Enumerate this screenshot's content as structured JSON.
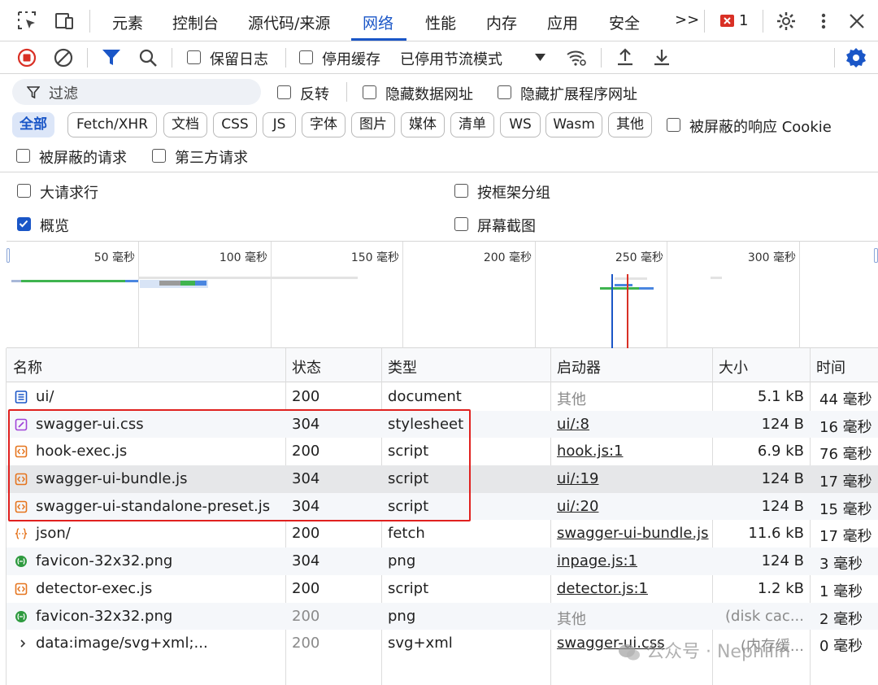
{
  "tabs": [
    "元素",
    "控制台",
    "源代码/来源",
    "网络",
    "性能",
    "内存",
    "应用",
    "安全"
  ],
  "tabbar": {
    "more": ">>",
    "error_count": "1"
  },
  "toolbar": {
    "preserve_log": "保留日志",
    "disable_cache": "停用缓存",
    "throttling": "已停用节流模式"
  },
  "filter": {
    "placeholder": "过滤",
    "invert": "反转",
    "hide_data_urls": "隐藏数据网址",
    "hide_extension_urls": "隐藏扩展程序网址",
    "blocked_cookies": "被屏蔽的响应 Cookie",
    "blocked_requests": "被屏蔽的请求",
    "third_party": "第三方请求"
  },
  "type_filters": [
    "全部",
    "Fetch/XHR",
    "文档",
    "CSS",
    "JS",
    "字体",
    "图片",
    "媒体",
    "清单",
    "WS",
    "Wasm",
    "其他"
  ],
  "settings": {
    "big_rows": "大请求行",
    "group_by_frame": "按框架分组",
    "overview": "概览",
    "screenshots": "屏幕截图"
  },
  "timeline": {
    "labels": [
      "50 毫秒",
      "100 毫秒",
      "150 毫秒",
      "200 毫秒",
      "250 毫秒",
      "300 毫秒"
    ]
  },
  "table": {
    "headers": [
      "名称",
      "状态",
      "类型",
      "启动器",
      "大小",
      "时间"
    ],
    "rows": [
      {
        "name": "ui/",
        "status": "200",
        "type": "document",
        "initiator": "其他",
        "size": "5.1 kB",
        "time": "44 毫秒",
        "icon": "document-icon"
      },
      {
        "name": "swagger-ui.css",
        "status": "304",
        "type": "stylesheet",
        "initiator": "ui/:8",
        "size": "124 B",
        "time": "16 毫秒",
        "icon": "stylesheet-icon"
      },
      {
        "name": "hook-exec.js",
        "status": "200",
        "type": "script",
        "initiator": "hook.js:1",
        "size": "6.9 kB",
        "time": "76 毫秒",
        "icon": "script-icon"
      },
      {
        "name": "swagger-ui-bundle.js",
        "status": "304",
        "type": "script",
        "initiator": "ui/:19",
        "size": "124 B",
        "time": "17 毫秒",
        "icon": "script-icon"
      },
      {
        "name": "swagger-ui-standalone-preset.js",
        "status": "304",
        "type": "script",
        "initiator": "ui/:20",
        "size": "124 B",
        "time": "15 毫秒",
        "icon": "script-icon"
      },
      {
        "name": "json/",
        "status": "200",
        "type": "fetch",
        "initiator": "swagger-ui-bundle.js",
        "size": "11.6 kB",
        "time": "17 毫秒",
        "icon": "fetch-icon"
      },
      {
        "name": "favicon-32x32.png",
        "status": "304",
        "type": "png",
        "initiator": "inpage.js:1",
        "size": "124 B",
        "time": "3 毫秒",
        "icon": "image-icon"
      },
      {
        "name": "detector-exec.js",
        "status": "200",
        "type": "script",
        "initiator": "detector.js:1",
        "size": "1.2 kB",
        "time": "1 毫秒",
        "icon": "script-icon"
      },
      {
        "name": "favicon-32x32.png",
        "status": "200",
        "type": "png",
        "initiator": "其他",
        "size": "(disk cac...",
        "time": "2 毫秒",
        "icon": "image-icon"
      },
      {
        "name": "data:image/svg+xml;...",
        "status": "200",
        "type": "svg+xml",
        "initiator": "swagger-ui.css",
        "size": "(内存缓...",
        "time": "0 毫秒",
        "icon": "chevron-right-icon"
      }
    ]
  },
  "watermark": "公众号 · Nephilin",
  "colors": {
    "accent": "#1a56c7",
    "highlight": "#e0211f",
    "script": "#e5741d",
    "stylesheet": "#a044d8",
    "image": "#2e9a3f"
  }
}
